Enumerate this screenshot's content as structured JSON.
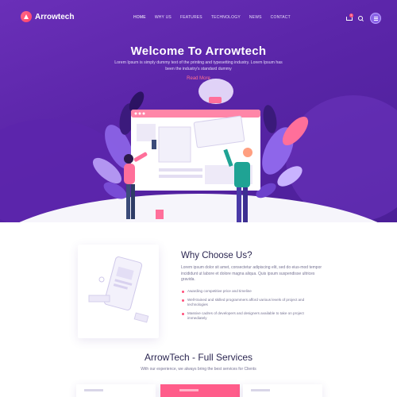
{
  "brand": {
    "name": "Arrowtech"
  },
  "nav": {
    "items": [
      "HOME",
      "WHY US",
      "FEATURES",
      "TECHNOLOGY",
      "NEWS",
      "CONTACT"
    ],
    "active": "HOME",
    "cart_count": "0"
  },
  "hero": {
    "title": "Welcome To Arrowtech",
    "subtitle": "Lorem Ipsum is simply dummy text of the printing and typesetting industry. Lorem Ipsum has been the industry's standard dummy",
    "cta": "Read More"
  },
  "why": {
    "title": "Why Choose Us?",
    "text": "Lorem ipsum dolor sit amet, consectetur adipiscing elit, sed do eius-mod tempor incididunt ut labore et dolore magna aliqua. Quis ipsum suspendisse ultrices gravida.",
    "points": [
      "Awarding competitive price and timeline",
      "Well-trained and skilled programmers afford various levels of project and technologies",
      "Massive cadres of developers and designers available to take on project immediately"
    ]
  },
  "services": {
    "title": "ArrowTech - Full Services",
    "subtitle": "With our experience, we always bring the best services for Clients"
  },
  "colors": {
    "hero_purple": "#5a25a8",
    "accent_pink": "#ff4f7a",
    "heading": "#2c2752"
  }
}
